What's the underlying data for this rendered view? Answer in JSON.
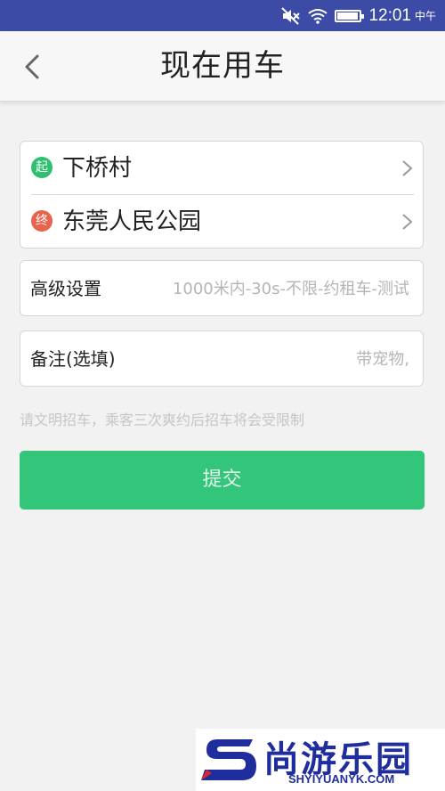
{
  "status_bar": {
    "time": "12:01",
    "ampm": "中午",
    "battery_level": 0.95,
    "icons": [
      "mute-icon",
      "wifi-icon",
      "battery-icon"
    ]
  },
  "header": {
    "title": "现在用车",
    "back_icon": "chevron-left-icon"
  },
  "route": {
    "start_badge": "起",
    "start": "下桥村",
    "end_badge": "终",
    "end": "东莞人民公园"
  },
  "advanced": {
    "label": "高级设置",
    "value": "1000米内-30s-不限-约租车-测试"
  },
  "note": {
    "label": "备注(选填)",
    "placeholder": "带宠物,"
  },
  "tip": "请文明招车，乘客三次爽约后招车将会受限制",
  "submit_label": "提交",
  "watermark": {
    "name": "尚游乐园",
    "url": "SHYIYUANYK.COM"
  },
  "colors": {
    "status_bar": "#3c4ba6",
    "primary_green": "#33c579",
    "start_badge": "#2fbf6e",
    "end_badge": "#e8644d",
    "watermark_blue": "#1f2e9c",
    "watermark_red": "#e0242a"
  }
}
